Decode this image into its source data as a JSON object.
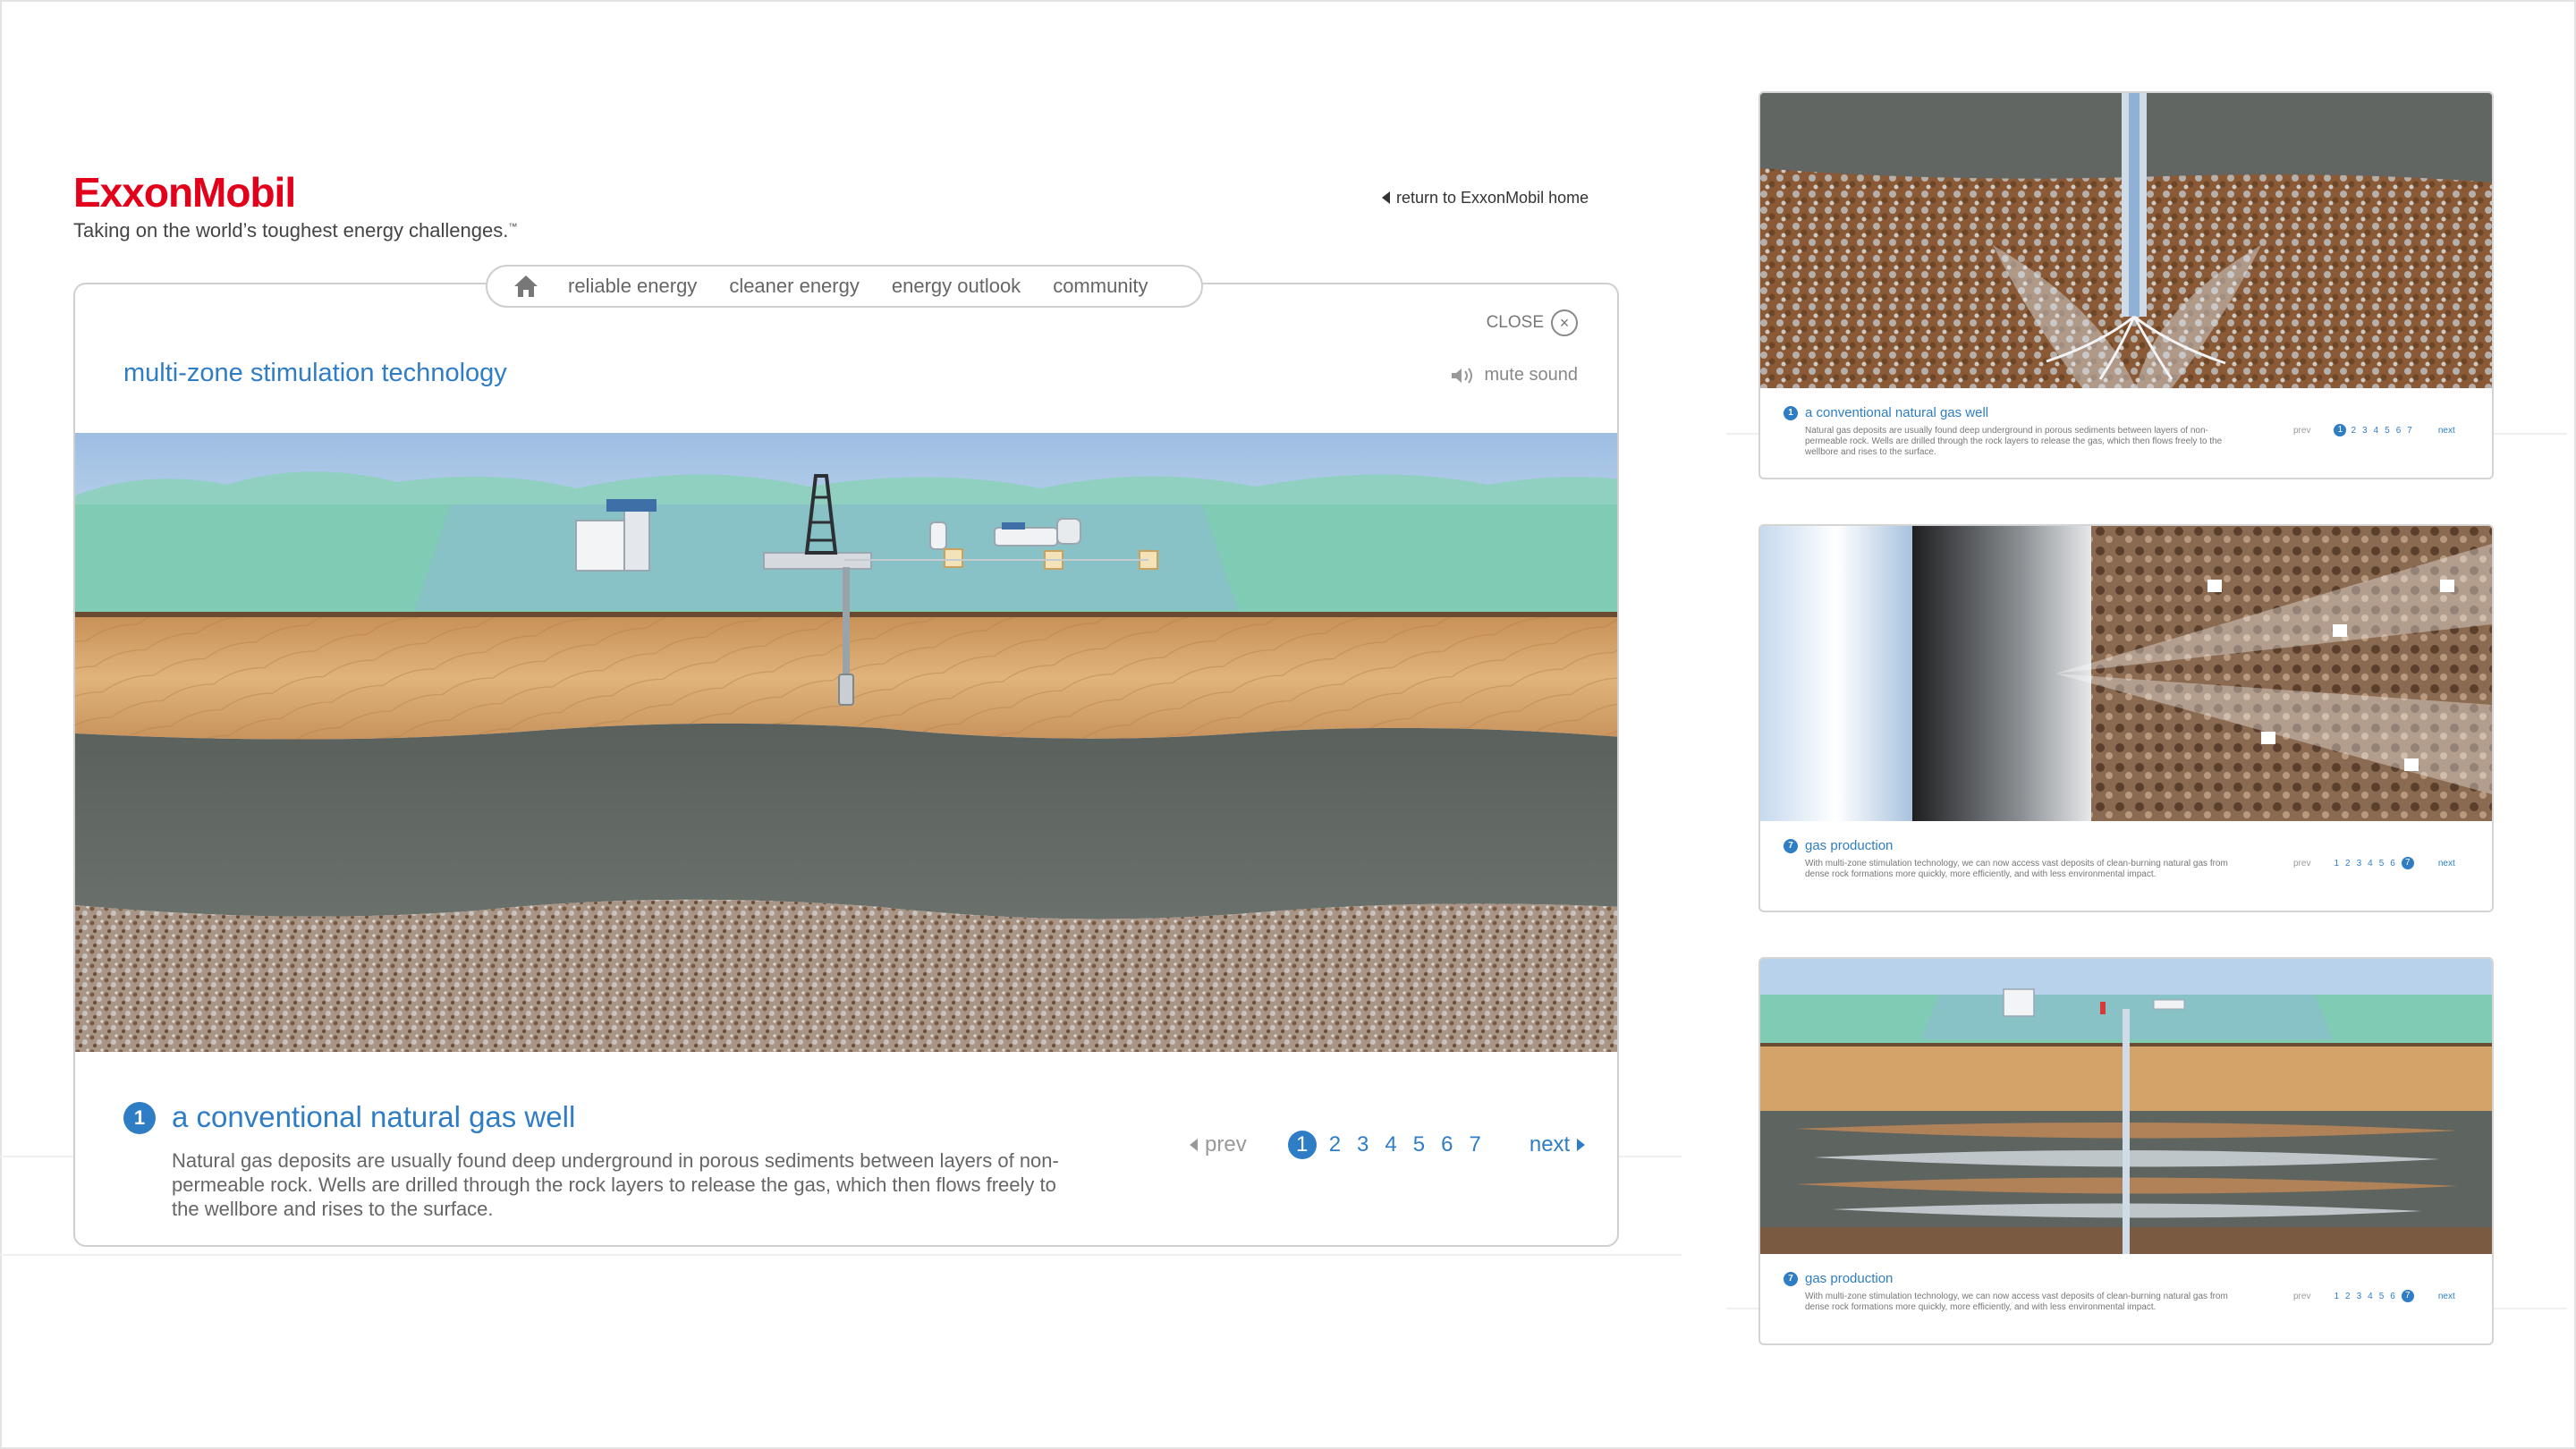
{
  "brand": {
    "logo_text": "ExxonMobil",
    "tagline": "Taking on the world’s toughest energy challenges.",
    "tagline_mark": "™",
    "return_link": "return to ExxonMobil home"
  },
  "nav": {
    "home_icon": "home-icon",
    "items": [
      "reliable energy",
      "cleaner energy",
      "energy outlook",
      "community"
    ]
  },
  "panel": {
    "title": "multi-zone stimulation technology",
    "close_label": "CLOSE",
    "close_glyph": "×",
    "mute_label": "mute sound"
  },
  "caption": {
    "number": "1",
    "title": "a conventional natural gas well",
    "body": "Natural gas deposits are usually found deep underground in porous sediments between layers of non-permeable rock. Wells are drilled through the rock layers to release the gas, which then flows freely to the wellbore and rises to the surface."
  },
  "pager": {
    "prev": "prev",
    "next": "next",
    "pages": [
      "1",
      "2",
      "3",
      "4",
      "5",
      "6",
      "7"
    ],
    "active_page": "1"
  },
  "thumbnails": [
    {
      "number": "1",
      "title": "a conventional natural gas well",
      "body": "Natural gas deposits are usually found deep underground in porous sediments between layers of non-permeable rock. Wells are drilled through the rock layers to release the gas, which then flows freely to the wellbore and rises to the surface.",
      "prev": "prev",
      "next": "next",
      "pages": [
        "1",
        "2",
        "3",
        "4",
        "5",
        "6",
        "7"
      ],
      "active_page": "1"
    },
    {
      "number": "7",
      "title": "gas production",
      "body": "With multi-zone stimulation technology, we can now access vast deposits of clean-burning natural gas from dense rock formations more quickly, more efficiently, and with less environmental impact.",
      "prev": "prev",
      "next": "next",
      "pages": [
        "1",
        "2",
        "3",
        "4",
        "5",
        "6",
        "7"
      ],
      "active_page": "7"
    },
    {
      "number": "7",
      "title": "gas production",
      "body": "With multi-zone stimulation technology, we can now access vast deposits of clean-burning natural gas from dense rock formations more quickly, more efficiently, and with less environmental impact.",
      "prev": "prev",
      "next": "next",
      "pages": [
        "1",
        "2",
        "3",
        "4",
        "5",
        "6",
        "7"
      ],
      "active_page": "7"
    }
  ],
  "colors": {
    "brand_red": "#e2001a",
    "accent_blue": "#2f7dc4",
    "sky": "#a9c6e6",
    "ground": "#7fcbb4",
    "sandstone": "#d7a66b",
    "shale": "#5e6460",
    "gravel": "#9a8778"
  }
}
